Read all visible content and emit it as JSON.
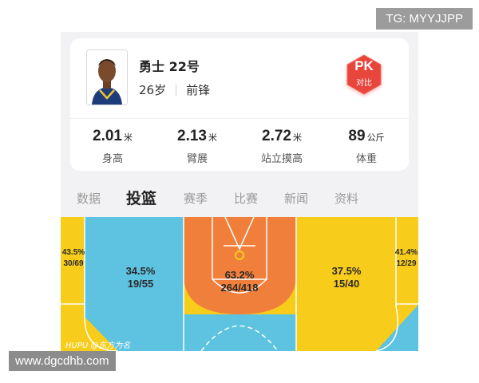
{
  "player": {
    "name": "勇士 22号",
    "age": "26岁",
    "position": "前锋"
  },
  "pk_button": {
    "label": "PK",
    "sub": "对比",
    "color": "#e8453c"
  },
  "stats": [
    {
      "value": "2.01",
      "unit": "米",
      "label": "身高"
    },
    {
      "value": "2.13",
      "unit": "米",
      "label": "臂展"
    },
    {
      "value": "2.72",
      "unit": "米",
      "label": "站立摸高"
    },
    {
      "value": "89",
      "unit": "公斤",
      "label": "体重"
    }
  ],
  "tabs": [
    {
      "label": "数据",
      "active": false
    },
    {
      "label": "投篮",
      "active": true
    },
    {
      "label": "赛季",
      "active": false
    },
    {
      "label": "比赛",
      "active": false
    },
    {
      "label": "新闻",
      "active": false
    },
    {
      "label": "资料",
      "active": false
    }
  ],
  "zones": {
    "left_corner": {
      "pct": "43.5%",
      "made": "30/69"
    },
    "left_wing": {
      "pct": "34.5%",
      "made": "19/55"
    },
    "paint": {
      "pct": "63.2%",
      "made": "264/418"
    },
    "right_wing": {
      "pct": "37.5%",
      "made": "15/40"
    },
    "right_corner": {
      "pct": "41.4%",
      "made": "12/29"
    }
  },
  "colors": {
    "yellow": "#f8cc1b",
    "blue": "#5ec3e0",
    "orange": "#f07f3c"
  },
  "watermark": "HUPU @东方为名",
  "overlay": {
    "tg": "TG: MYYJJPP",
    "url": "www.dgcdhb.com"
  }
}
